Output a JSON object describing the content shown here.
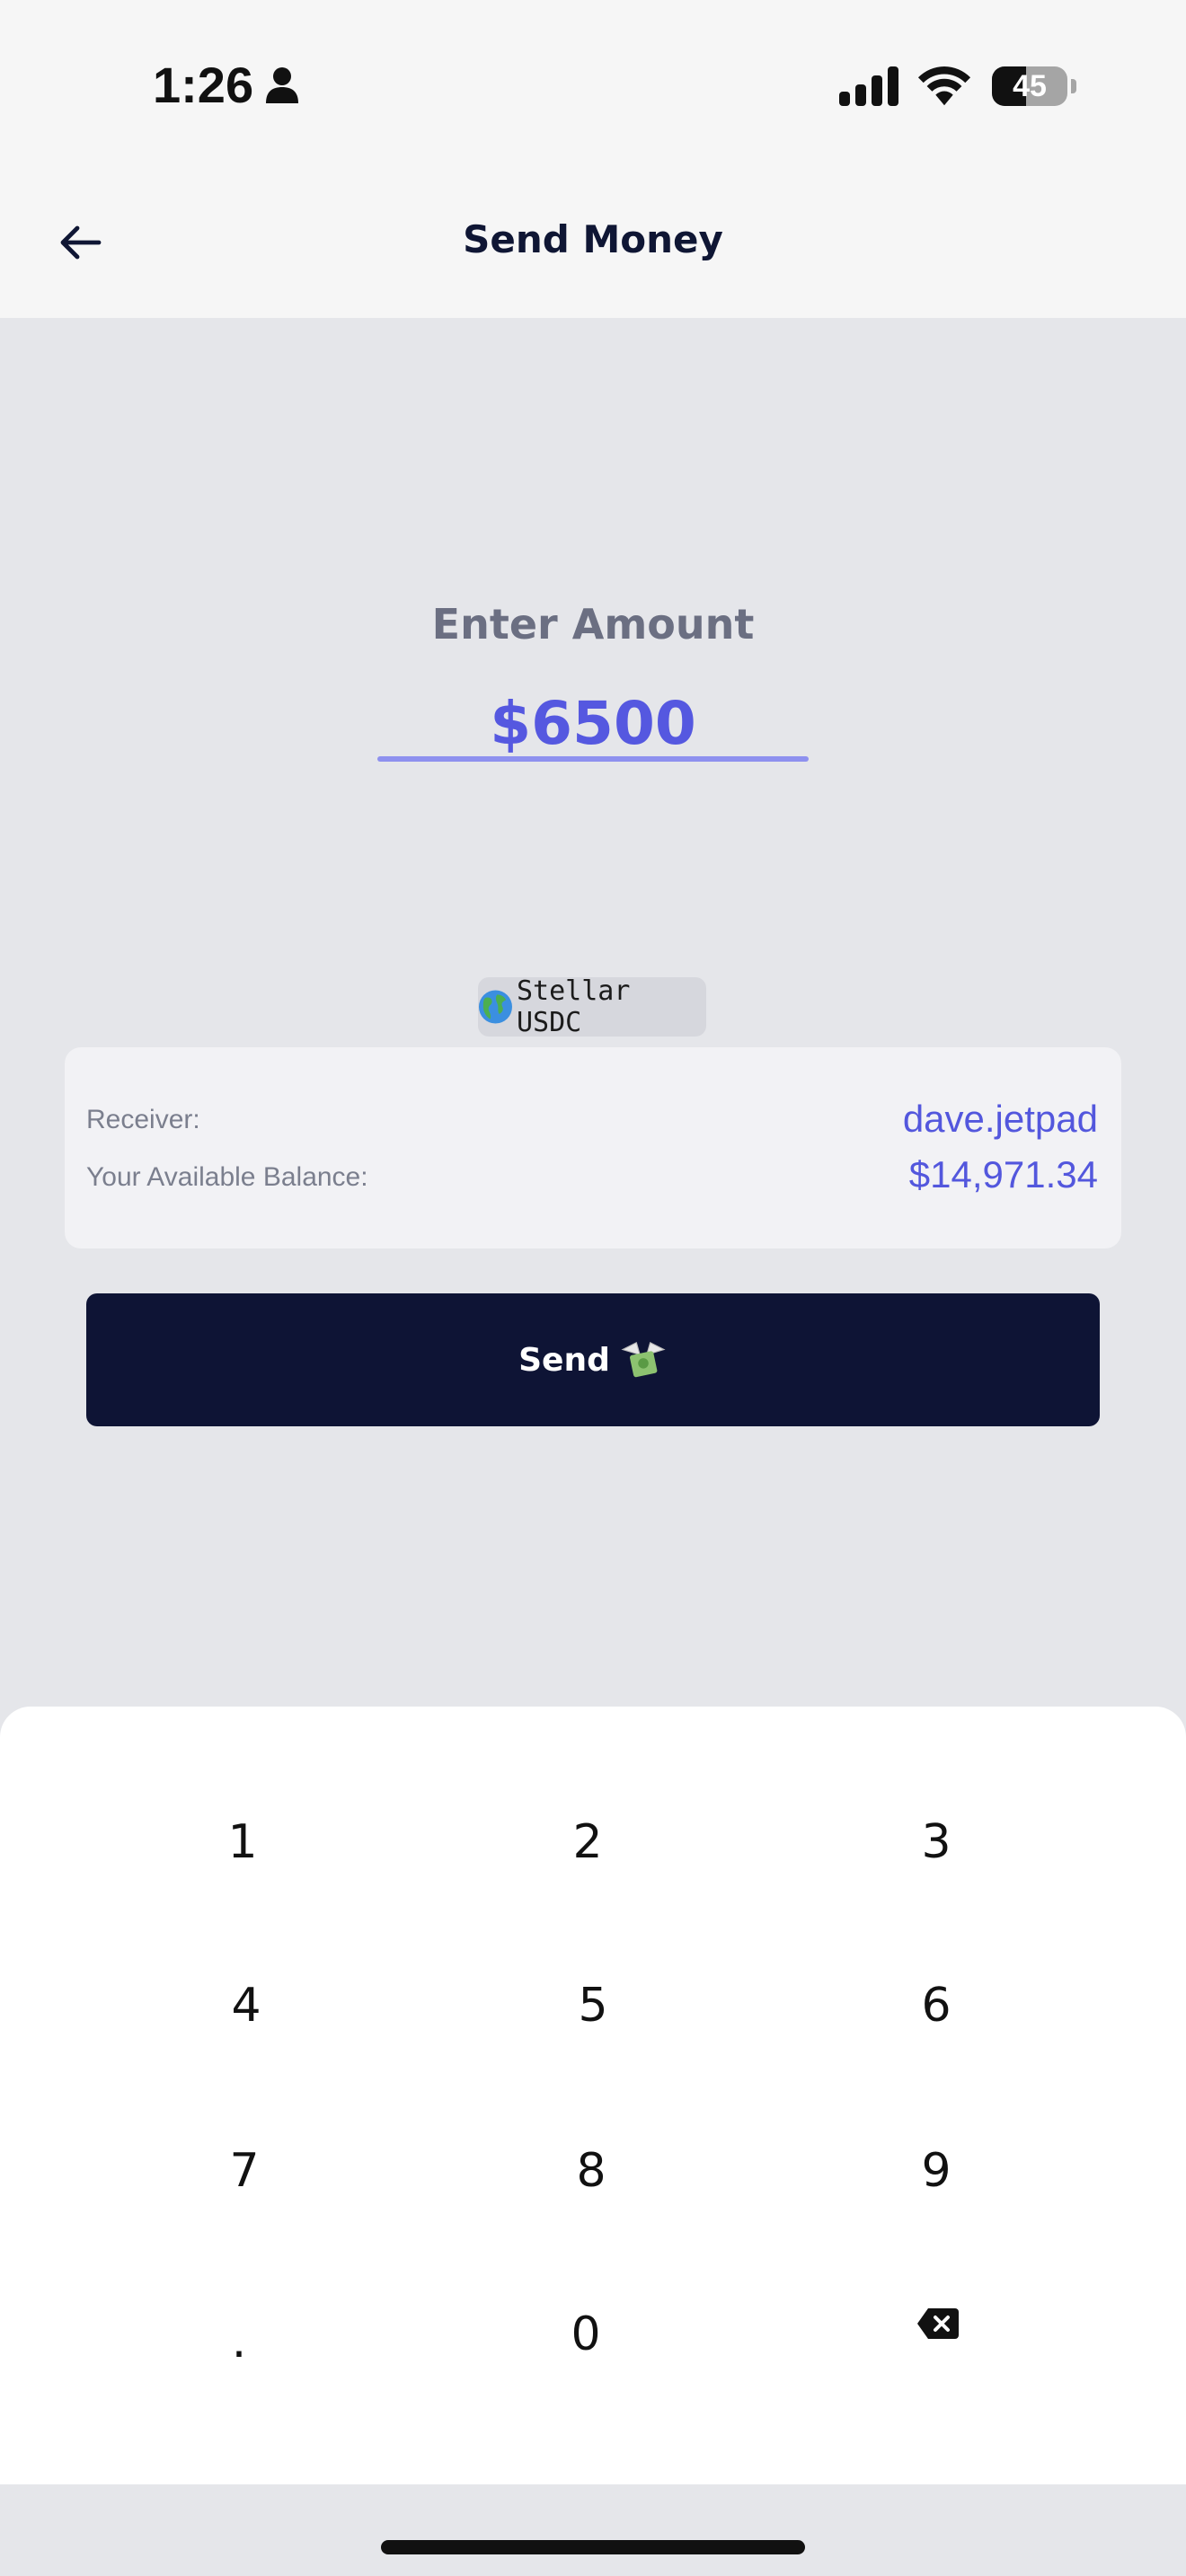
{
  "status": {
    "time": "1:26",
    "battery": "45",
    "battery_level": 0.45
  },
  "header": {
    "title": "Send Money"
  },
  "amount": {
    "label": "Enter Amount",
    "value": "$6500"
  },
  "network": {
    "label": "Stellar USDC"
  },
  "details": {
    "receiver_label": "Receiver:",
    "receiver_value": "dave.jetpad",
    "balance_label": "Your Available Balance:",
    "balance_value": "$14,971.34"
  },
  "actions": {
    "send_label": "Send"
  },
  "keypad": {
    "keys": [
      "1",
      "2",
      "3",
      "4",
      "5",
      "6",
      "7",
      "8",
      "9",
      ".",
      "0"
    ]
  },
  "colors": {
    "accent": "#5558e0",
    "primary_dark": "#0e1435",
    "background": "#e5e6ea"
  }
}
